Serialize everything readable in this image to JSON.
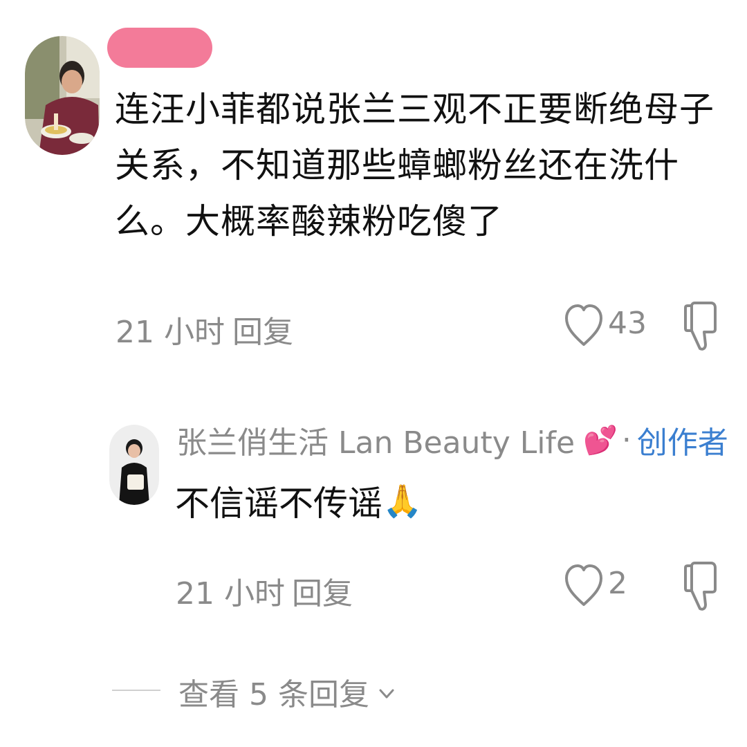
{
  "comment": {
    "avatar_icon": "user-avatar-photo",
    "redacted_name_color": "#f37b99",
    "text": "连汪小菲都说张兰三观不正要断绝母子关系，不知道那些蟑螂粉丝还在洗什么。大概率酸辣粉吃傻了",
    "time": "21 小时",
    "reply_label": "回复",
    "like_count": "43",
    "like_icon": "heart-outline-icon",
    "dislike_icon": "thumbs-down-icon"
  },
  "reply": {
    "avatar_icon": "creator-avatar-photo",
    "author_name": "张兰俏生活 Lan Beauty Life",
    "author_emoji": "💕",
    "separator": "·",
    "creator_badge": "创作者",
    "creator_color": "#3b7fd0",
    "text": "不信谣不传谣",
    "text_emoji": "🙏",
    "time": "21 小时",
    "reply_label": "回复",
    "like_count": "2",
    "like_icon": "heart-outline-icon",
    "dislike_icon": "thumbs-down-icon"
  },
  "view_more": {
    "label": "查看 5 条回复",
    "chevron_icon": "chevron-down-icon"
  }
}
